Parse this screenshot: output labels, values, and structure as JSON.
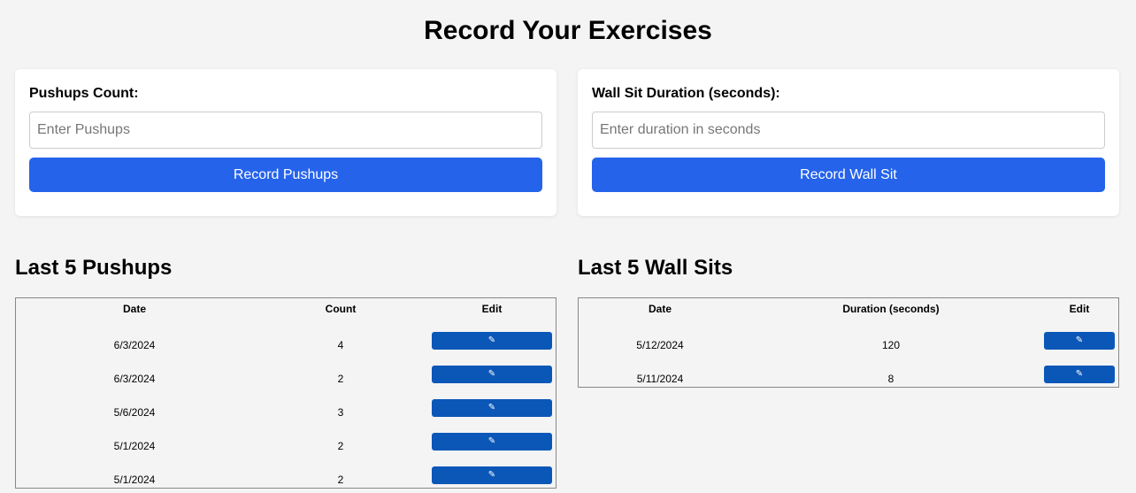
{
  "page": {
    "title": "Record Your Exercises"
  },
  "pushups_form": {
    "label": "Pushups Count:",
    "placeholder": "Enter Pushups",
    "value": "",
    "button_label": "Record Pushups"
  },
  "wallsit_form": {
    "label": "Wall Sit Duration (seconds):",
    "placeholder": "Enter duration in seconds",
    "value": "",
    "button_label": "Record Wall Sit"
  },
  "pushups_table": {
    "heading": "Last 5 Pushups",
    "columns": [
      "Date",
      "Count",
      "Edit"
    ],
    "rows": [
      {
        "date": "6/3/2024",
        "count": "4",
        "edit_icon": "✎"
      },
      {
        "date": "6/3/2024",
        "count": "2",
        "edit_icon": "✎"
      },
      {
        "date": "5/6/2024",
        "count": "3",
        "edit_icon": "✎"
      },
      {
        "date": "5/1/2024",
        "count": "2",
        "edit_icon": "✎"
      },
      {
        "date": "5/1/2024",
        "count": "2",
        "edit_icon": "✎"
      }
    ]
  },
  "wallsit_table": {
    "heading": "Last 5 Wall Sits",
    "columns": [
      "Date",
      "Duration (seconds)",
      "Edit"
    ],
    "rows": [
      {
        "date": "5/12/2024",
        "duration": "120",
        "edit_icon": "✎"
      },
      {
        "date": "5/11/2024",
        "duration": "8",
        "edit_icon": "✎"
      }
    ]
  },
  "colors": {
    "background": "#f4f4f4",
    "primary_button": "#2563eb",
    "edit_button": "#0b57b8"
  },
  "icons": {
    "edit": "edit-icon"
  }
}
